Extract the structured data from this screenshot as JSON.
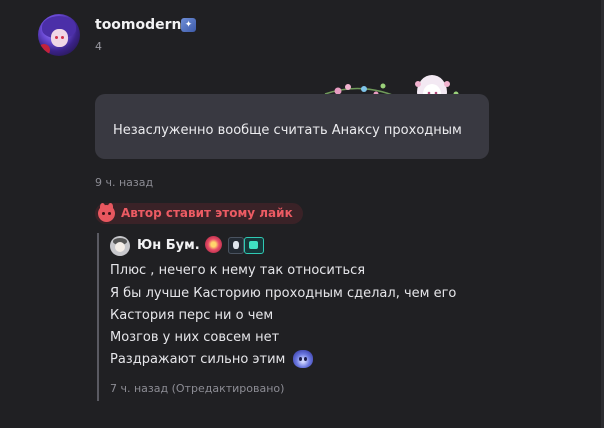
{
  "post": {
    "username": "toomodern",
    "level": "4",
    "message": "Незаслуженно вообще считать Анаксу проходным",
    "time": "9 ч. назад"
  },
  "like_chip": {
    "label": "Автор ставит этому лайк"
  },
  "reply": {
    "username": "Юн Бум.",
    "lines": [
      "Плюс , нечего к нему так относиться",
      "Я бы лучше Касторию проходным сделал, чем его",
      "Кастория перс ни о чем",
      "Мозгов у них совсем нет",
      "Раздражают сильно этим"
    ],
    "time": "7 ч. назад (Отредактировано)"
  },
  "icons": {
    "user_badge": "badge-icon",
    "like": "cat-heart-icon",
    "reply_flower": "flower-icon",
    "reply_badge_1": "character-badge-icon",
    "reply_badge_2": "green-badge-icon",
    "line_emoji": "ghost-emoji-icon",
    "bubble_decoration": "floral-frame-decoration"
  },
  "colors": {
    "background": "#202023",
    "bubble": "#393941",
    "like_text": "#ec5b63",
    "like_chip_bg": "#3a2227",
    "muted": "#8c8c94"
  }
}
